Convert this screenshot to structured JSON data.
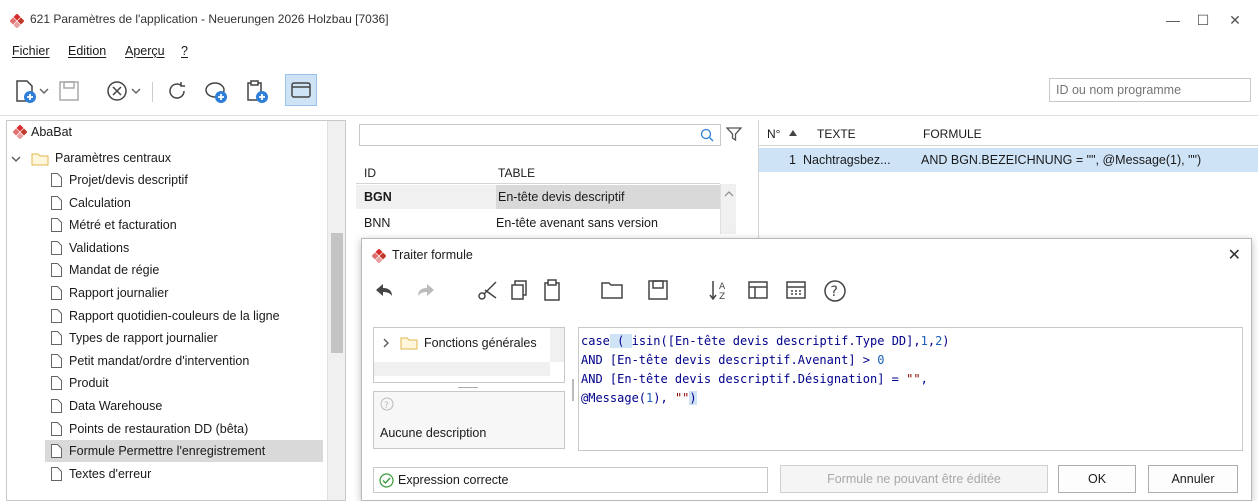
{
  "window": {
    "title": "621 Paramètres de l'application - Neuerungen 2026 Holzbau [7036]",
    "min_glyph": "—",
    "max_glyph": "☐",
    "close_glyph": "✕"
  },
  "menu": [
    "Fichier",
    "Edition",
    "Aperçu",
    "?"
  ],
  "search": {
    "placeholder": "ID ou nom programme"
  },
  "tree": {
    "root": "AbaBat",
    "group": "Paramètres centraux",
    "items": [
      "Projet/devis descriptif",
      "Calculation",
      "Métré et facturation",
      "Validations",
      "Mandat de régie",
      "Rapport journalier",
      "Rapport quotidien-couleurs de la ligne",
      "Types de rapport journalier",
      "Petit mandat/ordre d'intervention",
      "Produit",
      "Data Warehouse",
      "Points de restauration DD (bêta)",
      "Formule Permettre l'enregistrement",
      "Textes d'erreur"
    ],
    "selected_index": 12
  },
  "table": {
    "columns": [
      "ID",
      "TABLE"
    ],
    "rows": [
      {
        "id": "BGN",
        "table": "En-tête devis descriptif"
      },
      {
        "id": "BNN",
        "table": "En-tête avenant sans version"
      }
    ]
  },
  "formulas": {
    "columns": [
      "N°",
      "TEXTE",
      "FORMULE"
    ],
    "rows": [
      {
        "no": "1",
        "text": "Nachtragsbez...",
        "formula": "AND BGN.BEZEICHNUNG = \"\", @Message(1), \"\")"
      }
    ]
  },
  "dialog": {
    "title": "Traiter formule",
    "function_tree": "Fonctions générales",
    "description": "Aucune description",
    "status": "Expression correcte",
    "readonly_button": "Formule ne pouvant être éditée",
    "ok": "OK",
    "cancel": "Annuler",
    "code_lines": [
      [
        {
          "t": "case",
          "c": "kw"
        },
        {
          "t": " ( ",
          "c": "hl"
        },
        {
          "t": "isin",
          "c": "kw"
        },
        {
          "t": "([En-tête devis descriptif.Type DD],",
          "c": "kw"
        },
        {
          "t": "1",
          "c": "num"
        },
        {
          "t": ",",
          "c": "kw"
        },
        {
          "t": "2",
          "c": "num"
        },
        {
          "t": ")",
          "c": "kw"
        }
      ],
      [
        {
          "t": "AND ",
          "c": "kw"
        },
        {
          "t": "[En-tête devis descriptif.Avenant]",
          "c": "kw"
        },
        {
          "t": " > ",
          "c": "kw"
        },
        {
          "t": "0",
          "c": "num"
        }
      ],
      [
        {
          "t": "AND ",
          "c": "kw"
        },
        {
          "t": "[En-tête devis descriptif.Désignation]",
          "c": "kw"
        },
        {
          "t": " = ",
          "c": "kw"
        },
        {
          "t": "\"\"",
          "c": "str"
        },
        {
          "t": ",",
          "c": "kw"
        }
      ],
      [
        {
          "t": "@Message",
          "c": "kw"
        },
        {
          "t": "(",
          "c": "kw"
        },
        {
          "t": "1",
          "c": "num"
        },
        {
          "t": "), ",
          "c": "kw"
        },
        {
          "t": "\"\"",
          "c": "str"
        },
        {
          "t": ")",
          "c": "hl"
        }
      ]
    ]
  },
  "colors": {
    "accent": "#2f7fd8",
    "brand": "#d62e2e",
    "selection": "#cfe3f7"
  },
  "icons": [
    "new-doc-icon",
    "save-icon",
    "cancel-icon",
    "refresh-icon",
    "comment-add-icon",
    "clipboard-add-icon",
    "window-icon",
    "search-icon",
    "filter-icon",
    "undo-icon",
    "redo-icon",
    "cut-icon",
    "copy-icon",
    "paste-icon",
    "folder-icon",
    "save-icon",
    "sort-icon",
    "table-icon",
    "calculator-icon",
    "help-icon"
  ]
}
